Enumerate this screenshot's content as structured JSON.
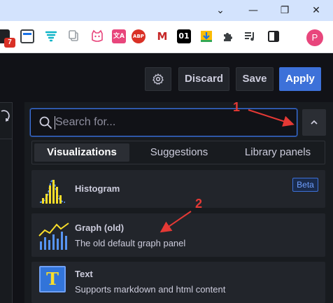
{
  "browser": {
    "window_controls": [
      "chevron-down-icon",
      "minimize-icon",
      "restore-icon",
      "close-icon"
    ],
    "extensions": [
      {
        "name": "calendar-ext-icon",
        "badge": "7"
      },
      {
        "name": "window-ext-icon"
      },
      {
        "name": "funnel-ext-icon"
      },
      {
        "name": "copy-ext-icon"
      },
      {
        "name": "cat-ext-icon"
      },
      {
        "name": "translate-ext-icon",
        "label": "文A"
      },
      {
        "name": "adblock-ext-icon",
        "label": "ABP"
      },
      {
        "name": "m-ext-icon",
        "label": "M"
      },
      {
        "name": "binary-ext-icon",
        "label": "01"
      },
      {
        "name": "download-ext-icon"
      },
      {
        "name": "puzzle-extensions-icon"
      },
      {
        "name": "playlist-icon"
      },
      {
        "name": "sidepanel-icon"
      }
    ],
    "profile_initial": "P"
  },
  "header": {
    "settings_icon": "gear-icon",
    "discard_label": "Discard",
    "save_label": "Save",
    "apply_label": "Apply"
  },
  "search": {
    "placeholder": "Search for...",
    "value": ""
  },
  "tabs": [
    {
      "label": "Visualizations",
      "active": true
    },
    {
      "label": "Suggestions",
      "active": false
    },
    {
      "label": "Library panels",
      "active": false
    }
  ],
  "visualizations": [
    {
      "title": "Histogram",
      "badge": "Beta",
      "icon": "histogram-icon"
    },
    {
      "title": "Graph (old)",
      "description": "The old default graph panel",
      "icon": "graph-old-icon"
    },
    {
      "title": "Text",
      "description": "Supports markdown and html content",
      "icon": "text-panel-icon",
      "icon_letter": "T"
    }
  ],
  "annotations": [
    {
      "number": "1",
      "color": "#e53935"
    },
    {
      "number": "2",
      "color": "#e53935"
    }
  ],
  "colors": {
    "accent": "#3d71d9",
    "background": "#111217",
    "panel": "#181b1f",
    "card": "#22252b",
    "annotation": "#e53935"
  }
}
